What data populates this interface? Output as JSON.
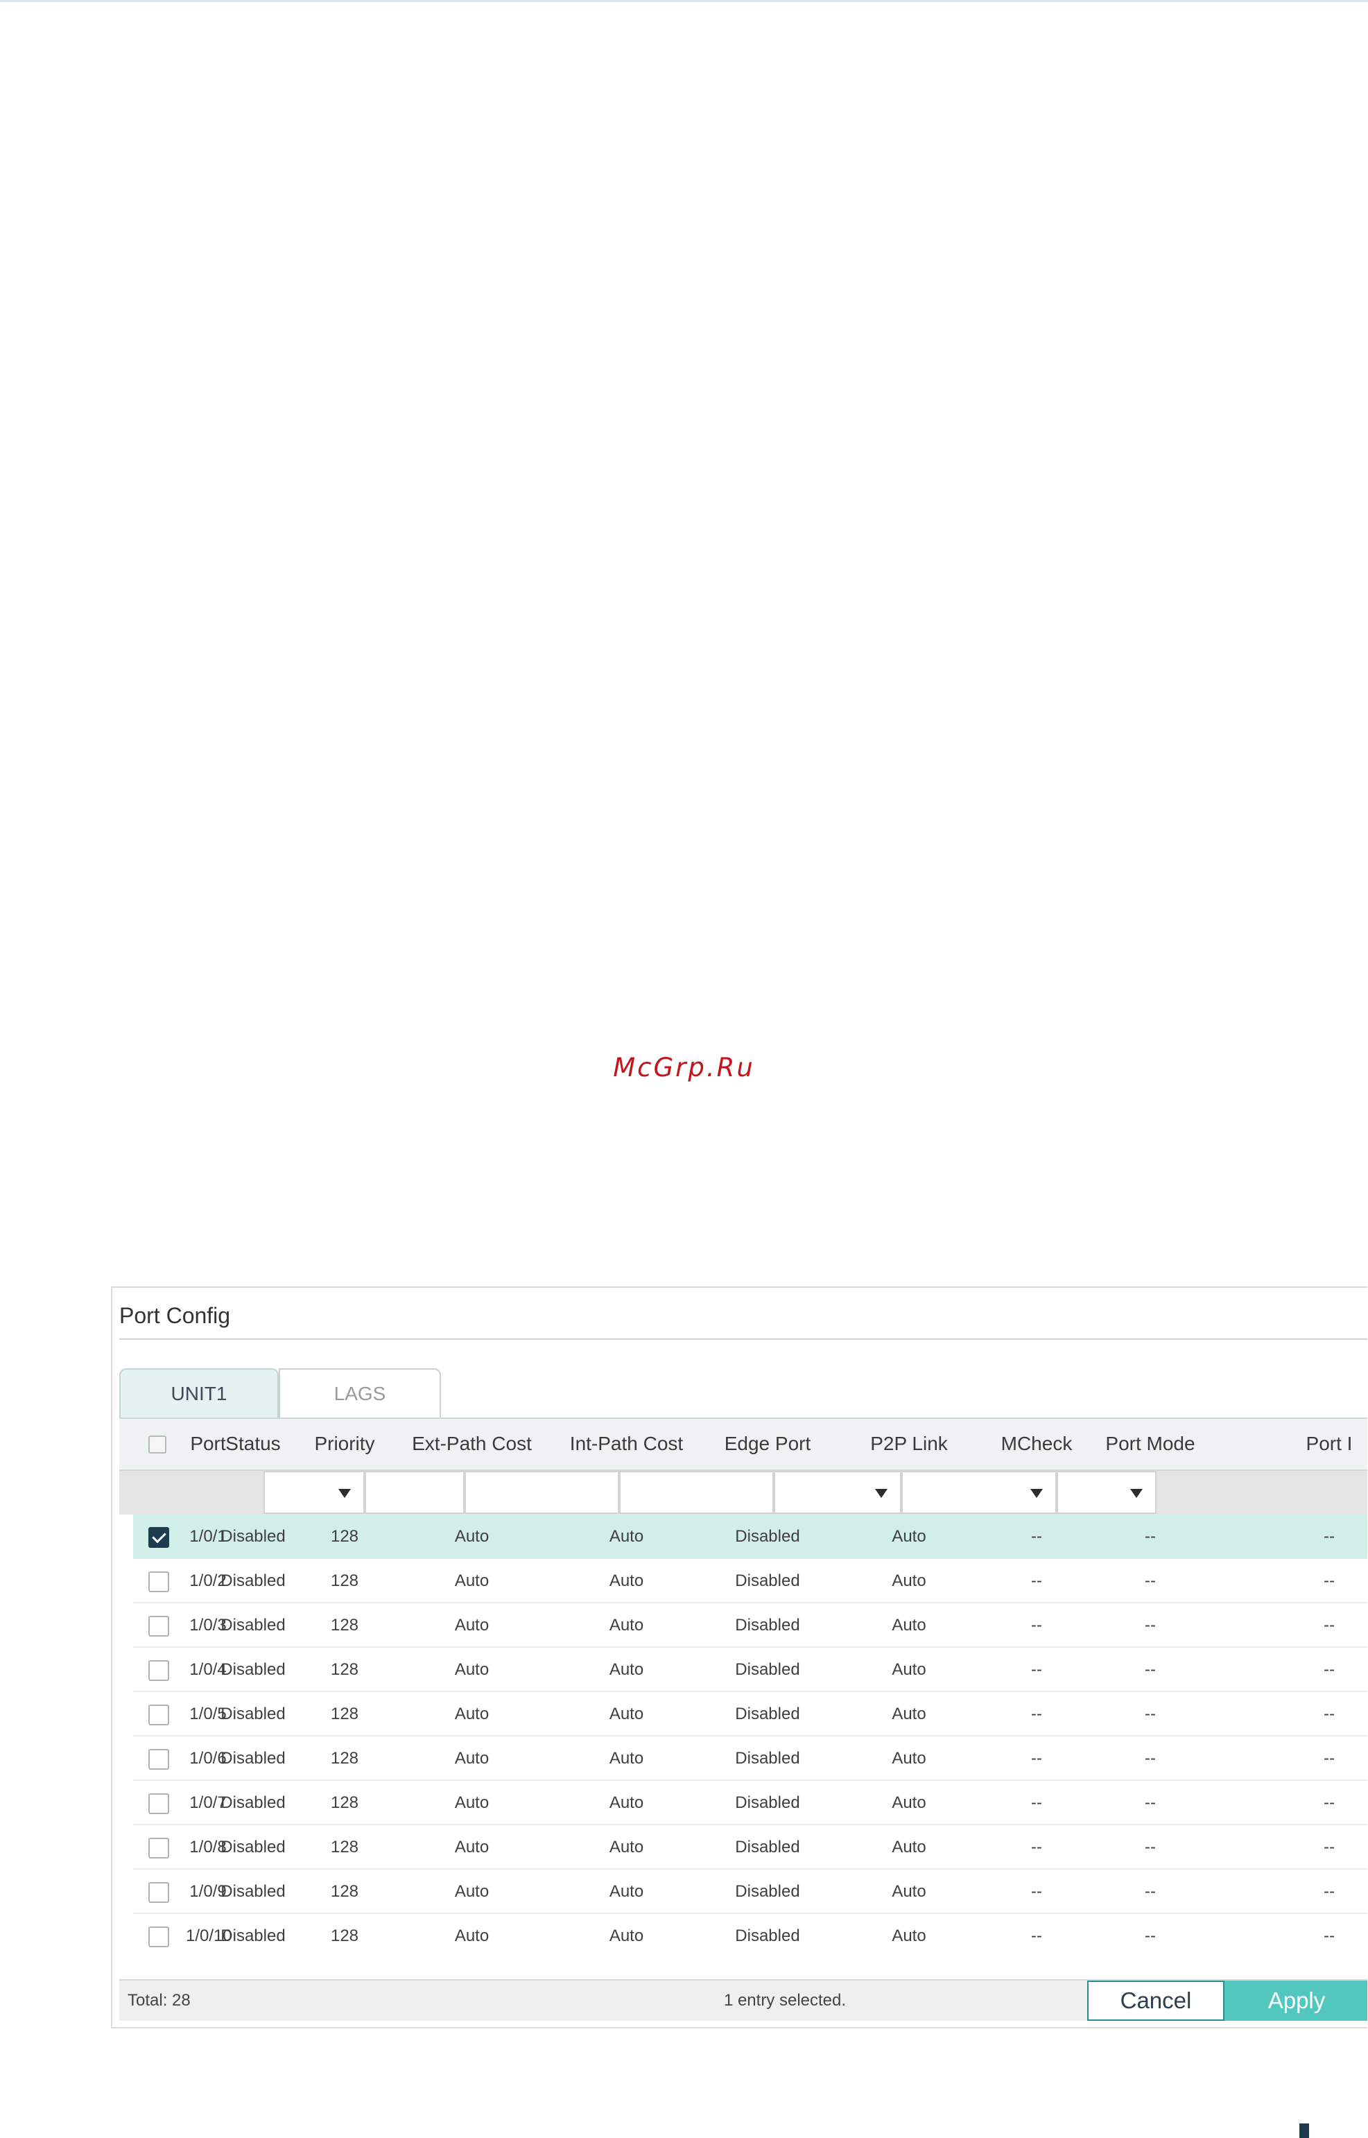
{
  "watermark": "McGrp.Ru",
  "panel": {
    "title": "Port Config"
  },
  "tabs": [
    {
      "label": "UNIT1",
      "active": true
    },
    {
      "label": "LAGS",
      "active": false
    }
  ],
  "table": {
    "columns": [
      "Port",
      "Status",
      "Priority",
      "Ext-Path Cost",
      "Int-Path Cost",
      "Edge Port",
      "P2P Link",
      "MCheck",
      "Port Mode",
      "Port I"
    ],
    "rows": [
      {
        "checked": true,
        "cells": [
          "1/0/1",
          "Disabled",
          "128",
          "Auto",
          "Auto",
          "Disabled",
          "Auto",
          "--",
          "--",
          "--"
        ]
      },
      {
        "checked": false,
        "cells": [
          "1/0/2",
          "Disabled",
          "128",
          "Auto",
          "Auto",
          "Disabled",
          "Auto",
          "--",
          "--",
          "--"
        ]
      },
      {
        "checked": false,
        "cells": [
          "1/0/3",
          "Disabled",
          "128",
          "Auto",
          "Auto",
          "Disabled",
          "Auto",
          "--",
          "--",
          "--"
        ]
      },
      {
        "checked": false,
        "cells": [
          "1/0/4",
          "Disabled",
          "128",
          "Auto",
          "Auto",
          "Disabled",
          "Auto",
          "--",
          "--",
          "--"
        ]
      },
      {
        "checked": false,
        "cells": [
          "1/0/5",
          "Disabled",
          "128",
          "Auto",
          "Auto",
          "Disabled",
          "Auto",
          "--",
          "--",
          "--"
        ]
      },
      {
        "checked": false,
        "cells": [
          "1/0/6",
          "Disabled",
          "128",
          "Auto",
          "Auto",
          "Disabled",
          "Auto",
          "--",
          "--",
          "--"
        ]
      },
      {
        "checked": false,
        "cells": [
          "1/0/7",
          "Disabled",
          "128",
          "Auto",
          "Auto",
          "Disabled",
          "Auto",
          "--",
          "--",
          "--"
        ]
      },
      {
        "checked": false,
        "cells": [
          "1/0/8",
          "Disabled",
          "128",
          "Auto",
          "Auto",
          "Disabled",
          "Auto",
          "--",
          "--",
          "--"
        ]
      },
      {
        "checked": false,
        "cells": [
          "1/0/9",
          "Disabled",
          "128",
          "Auto",
          "Auto",
          "Disabled",
          "Auto",
          "--",
          "--",
          "--"
        ]
      },
      {
        "checked": false,
        "cells": [
          "1/0/10",
          "Disabled",
          "128",
          "Auto",
          "Auto",
          "Disabled",
          "Auto",
          "--",
          "--",
          "--"
        ]
      }
    ]
  },
  "footer": {
    "total": "Total: 28",
    "selected": "1 entry selected.",
    "cancel_label": "Cancel",
    "apply_label": "Apply"
  },
  "colors": {
    "accent": "#51c7be",
    "selected_row": "#d2eee9",
    "checkbox_checked": "#1e3c50",
    "watermark": "#c4141c"
  }
}
